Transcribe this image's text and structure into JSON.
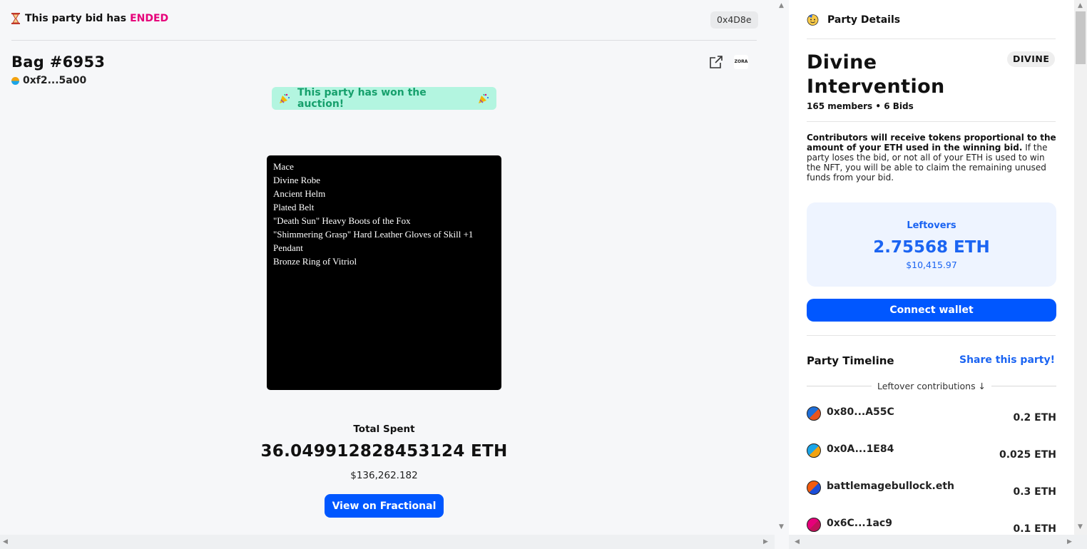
{
  "status": {
    "prefix": "This party bid has",
    "state": "ENDED",
    "address_chip": "0x4D8e"
  },
  "nft": {
    "title": "Bag #6953",
    "owner": "0xf2...5a00",
    "zora_label": "ZORA",
    "items": [
      "Mace",
      "Divine Robe",
      "Ancient Helm",
      "Plated Belt",
      "\"Death Sun\" Heavy Boots of the Fox",
      "\"Shimmering Grasp\" Hard Leather Gloves of Skill +1",
      "Pendant",
      "Bronze Ring of Vitriol"
    ]
  },
  "won_banner": "This party has won the auction!",
  "total": {
    "label": "Total Spent",
    "value": "36.049912828453124 ETH",
    "usd": "$136,262.182",
    "button": "View on Fractional"
  },
  "party": {
    "header": "Party Details",
    "name": "Divine Intervention",
    "ticker": "DIVINE",
    "members": "165 members • 6 Bids",
    "info_bold": "Contributors will receive tokens proportional to the amount of your ETH used in the winning bid.",
    "info_rest": " If the party loses the bid, or not all of your ETH is used to win the NFT, you will be able to claim the remaining unused funds from your bid.",
    "leftovers_label": "Leftovers",
    "leftovers_value": "2.75568 ETH",
    "leftovers_usd": "$10,415.97",
    "connect_button": "Connect wallet",
    "timeline_title": "Party Timeline",
    "share_link": "Share this party!",
    "leftover_contributions": "Leftover contributions ↓",
    "contributions": [
      {
        "name": "0x80...A55C",
        "amount": "0.2 ETH",
        "colors": [
          "#1e6fd9",
          "#e8541e"
        ]
      },
      {
        "name": "0x0A...1E84",
        "amount": "0.025 ETH",
        "colors": [
          "#1aa5e8",
          "#f2a20f"
        ]
      },
      {
        "name": "battlemagebullock.eth",
        "amount": "0.3 ETH",
        "colors": [
          "#f25c0f",
          "#1b4ed8"
        ]
      },
      {
        "name": "0x6C...1ac9",
        "amount": "0.1 ETH",
        "colors": [
          "#e6007a",
          "#c0115a"
        ]
      }
    ]
  },
  "colors": {
    "accent_blue": "#0057ff",
    "ended_pink": "#e6007a",
    "won_green_bg": "#b3f5e0",
    "won_green_text": "#16a06c"
  }
}
